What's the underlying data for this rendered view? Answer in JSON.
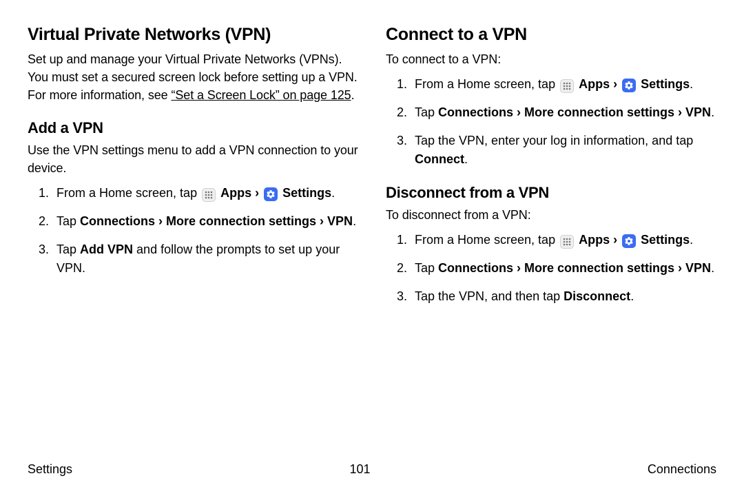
{
  "left": {
    "title": "Virtual Private Networks (VPN)",
    "intro_pre": "Set up and manage your Virtual Private Networks (VPNs). You must set a secured screen lock before setting up a VPN. For more information, see ",
    "intro_link": "“Set a Screen Lock” on page 125",
    "intro_post": ".",
    "add_title": "Add a VPN",
    "add_intro": "Use the VPN settings menu to add a VPN connection to your device.",
    "step1_pre": "From a Home screen, tap ",
    "apps_label": "Apps",
    "arrow": " › ",
    "settings_label": "Settings",
    "step2_pre": "Tap ",
    "step2_bold": "Connections › More connection settings › VPN",
    "step3_pre": "Tap ",
    "step3_bold": "Add VPN",
    "step3_post": " and follow the prompts to set up your VPN.",
    "period": "."
  },
  "right": {
    "connect_title": "Connect to a VPN",
    "connect_intro": "To connect to a VPN:",
    "step1_pre": "From a Home screen, tap ",
    "apps_label": "Apps",
    "arrow": " › ",
    "settings_label": "Settings",
    "step2_pre": "Tap ",
    "step2_bold": "Connections › More connection settings › VPN",
    "step3_pre": "Tap the VPN, enter your log in information, and tap ",
    "step3_bold": "Connect",
    "disconnect_title": "Disconnect from a VPN",
    "disconnect_intro": "To disconnect from a VPN:",
    "dstep3_pre": "Tap the VPN, and then tap ",
    "dstep3_bold": "Disconnect",
    "period": "."
  },
  "footer": {
    "left": "Settings",
    "center": "101",
    "right": "Connections"
  }
}
